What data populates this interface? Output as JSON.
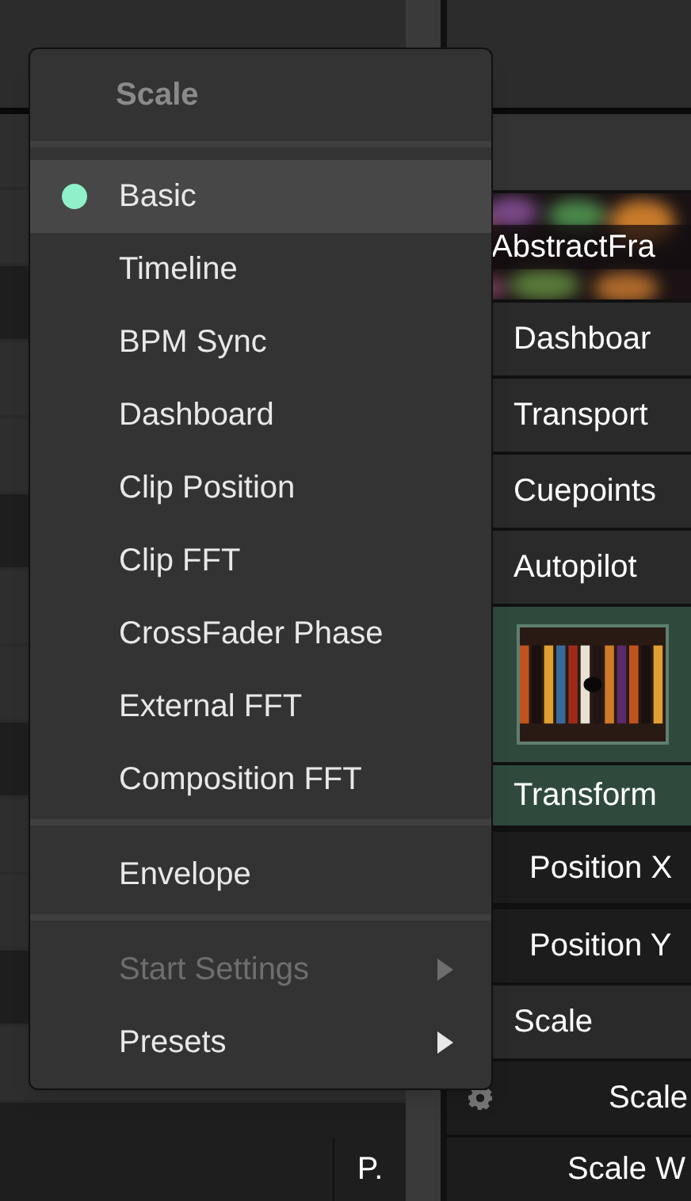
{
  "menu": {
    "title": "Scale",
    "sections": [
      [
        {
          "label": "Basic",
          "kind": "option",
          "selected": true,
          "disabled": false
        },
        {
          "label": "Timeline",
          "kind": "option",
          "selected": false,
          "disabled": false
        },
        {
          "label": "BPM Sync",
          "kind": "option",
          "selected": false,
          "disabled": false
        },
        {
          "label": "Dashboard",
          "kind": "option",
          "selected": false,
          "disabled": false
        },
        {
          "label": "Clip Position",
          "kind": "option",
          "selected": false,
          "disabled": false
        },
        {
          "label": "Clip FFT",
          "kind": "option",
          "selected": false,
          "disabled": false
        },
        {
          "label": "CrossFader Phase",
          "kind": "option",
          "selected": false,
          "disabled": false
        },
        {
          "label": "External FFT",
          "kind": "option",
          "selected": false,
          "disabled": false
        },
        {
          "label": "Composition FFT",
          "kind": "option",
          "selected": false,
          "disabled": false
        }
      ],
      [
        {
          "label": "Envelope",
          "kind": "option",
          "selected": false,
          "disabled": false
        }
      ],
      [
        {
          "label": "Start Settings",
          "kind": "submenu",
          "selected": false,
          "disabled": true
        },
        {
          "label": "Presets",
          "kind": "submenu",
          "selected": false,
          "disabled": false
        }
      ]
    ]
  },
  "left_panel": {
    "button": "P."
  },
  "right_panel": {
    "rows": [
      {
        "kind": "thumbnail",
        "label": "AbstractFra"
      },
      {
        "kind": "header",
        "label": "Dashboar"
      },
      {
        "kind": "header",
        "label": "Transport"
      },
      {
        "kind": "header",
        "label": "Cuepoints"
      },
      {
        "kind": "header",
        "label": "Autopilot"
      },
      {
        "kind": "preview"
      },
      {
        "kind": "group",
        "label": "Transform"
      },
      {
        "kind": "param",
        "label": "Position X"
      },
      {
        "kind": "param",
        "label": "Position Y"
      },
      {
        "kind": "header",
        "label": "Scale"
      },
      {
        "kind": "gear",
        "label": "Scale"
      },
      {
        "kind": "param2",
        "label": "Scale W"
      }
    ]
  }
}
